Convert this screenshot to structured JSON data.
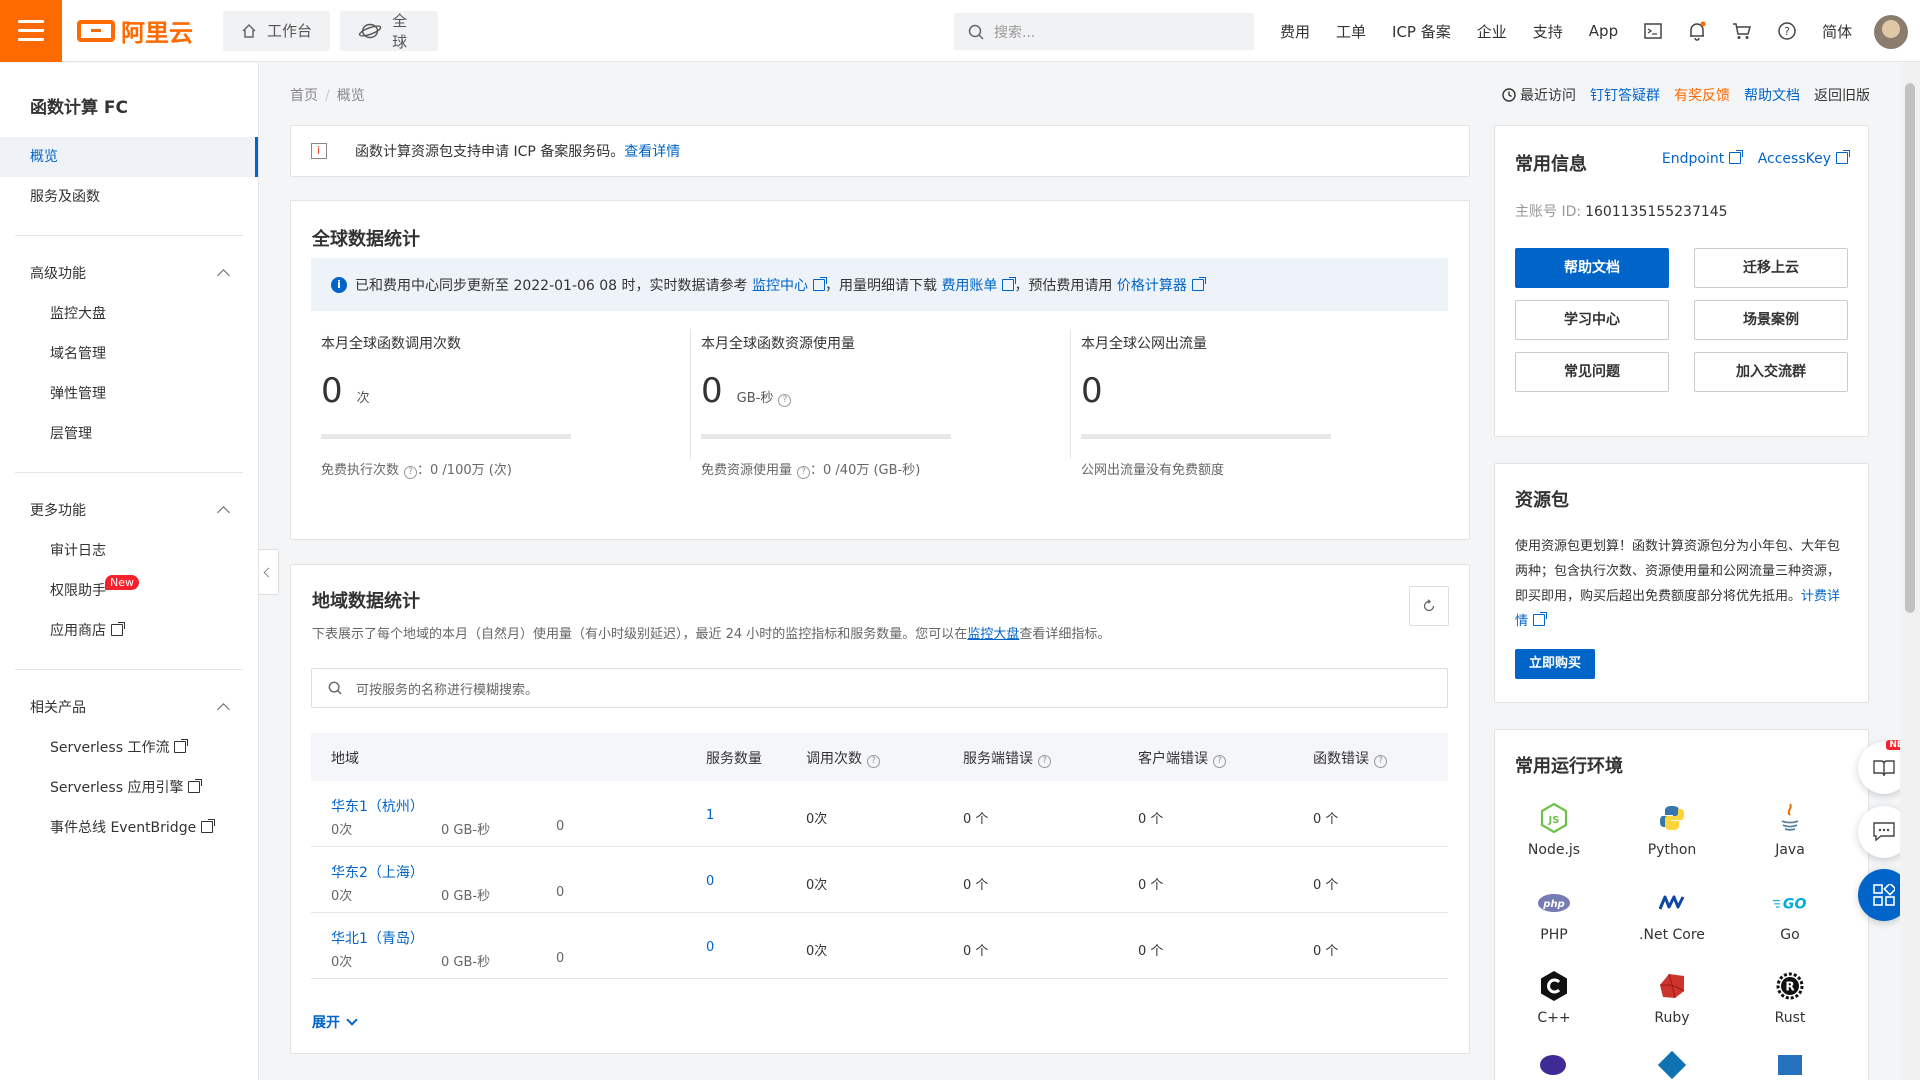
{
  "topbar": {
    "logo": "阿里云",
    "workbench": "工作台",
    "region": "全球",
    "search_placeholder": "搜索...",
    "nav": [
      "费用",
      "工单",
      "ICP 备案",
      "企业",
      "支持",
      "App"
    ],
    "lang": "简体",
    "brand_color": "#ff6a00"
  },
  "sidebar": {
    "title": "函数计算 FC",
    "items": [
      {
        "label": "概览"
      },
      {
        "label": "服务及函数"
      }
    ],
    "advanced": {
      "title": "高级功能",
      "items": [
        "监控大盘",
        "域名管理",
        "弹性管理",
        "层管理"
      ]
    },
    "more": {
      "title": "更多功能",
      "items": [
        "审计日志",
        "权限助手",
        "应用商店"
      ],
      "badge": "New"
    },
    "related": {
      "title": "相关产品",
      "items": [
        "Serverless 工作流",
        "Serverless 应用引擎",
        "事件总线 EventBridge"
      ]
    }
  },
  "breadcrumb": {
    "home": "首页",
    "current": "概览",
    "sep": "/"
  },
  "toplinks": {
    "recent": "最近访问",
    "dingding": "钉钉答疑群",
    "feedback": "有奖反馈",
    "docs": "帮助文档",
    "old": "返回旧版"
  },
  "notice": {
    "text": "函数计算资源包支持申请 ICP 备案服务码。",
    "link": "查看详情"
  },
  "global": {
    "title": "全球数据统计",
    "info": {
      "t1": "已和费用中心同步更新至 2022-01-06 08 时，实时数据请参考",
      "l1": "监控中心",
      "t2": "，用量明细请下载",
      "l2": "费用账单",
      "t3": "，预估费用请用",
      "l3": "价格计算器"
    },
    "stats": [
      {
        "label": "本月全球函数调用次数",
        "value": "0",
        "unit": "次",
        "foot": "免费执行次数",
        "foot_val": "：0 /100万 (次)"
      },
      {
        "label": "本月全球函数资源使用量",
        "value": "0",
        "unit": "GB-秒",
        "foot": "免费资源使用量",
        "foot_val": "：0 /40万 (GB-秒)"
      },
      {
        "label": "本月全球公网出流量",
        "value": "0",
        "unit": "",
        "foot": "公网出流量没有免费额度",
        "foot_val": ""
      }
    ]
  },
  "region": {
    "title": "地域数据统计",
    "desc1": "下表展示了每个地域的本月（自然月）使用量（有小时级别延迟），最近 24 小时的监控指标和服务数量。您可以在",
    "desc_link": "监控大盘",
    "desc2": "查看详细指标。",
    "search_placeholder": "可按服务的名称进行模糊搜索。",
    "headers": [
      "地域",
      "服务数量",
      "调用次数",
      "服务端错误",
      "客户端错误",
      "函数错误"
    ],
    "rows": [
      {
        "name": "华东1（杭州）",
        "sub1": "0次",
        "sub2": "0 GB-秒",
        "sub3": "0",
        "services": "1",
        "calls": "0次",
        "server_err": "0 个",
        "client_err": "0 个",
        "func_err": "0 个"
      },
      {
        "name": "华东2（上海）",
        "sub1": "0次",
        "sub2": "0 GB-秒",
        "sub3": "0",
        "services": "0",
        "calls": "0次",
        "server_err": "0 个",
        "client_err": "0 个",
        "func_err": "0 个"
      },
      {
        "name": "华北1（青岛）",
        "sub1": "0次",
        "sub2": "0 GB-秒",
        "sub3": "0",
        "services": "0",
        "calls": "0次",
        "server_err": "0 个",
        "client_err": "0 个",
        "func_err": "0 个"
      }
    ],
    "expand": "展开"
  },
  "info": {
    "title": "常用信息",
    "endpoint": "Endpoint",
    "accesskey": "AccessKey",
    "account_label": "主账号 ID:",
    "account_id": "1601135155237145",
    "buttons": [
      "帮助文档",
      "迁移上云",
      "学习中心",
      "场景案例",
      "常见问题",
      "加入交流群"
    ]
  },
  "package": {
    "title": "资源包",
    "text": "使用资源包更划算！函数计算资源包分为小年包、大年包两种；包含执行次数、资源使用量和公网流量三种资源，即买即用，购买后超出免费额度部分将优先抵用。",
    "link": "计费详情",
    "buy": "立即购买"
  },
  "runtimes": {
    "title": "常用运行环境",
    "items": [
      "Node.js",
      "Python",
      "Java",
      "PHP",
      ".Net Core",
      "Go",
      "C++",
      "Ruby",
      "Rust"
    ]
  },
  "float_badge": "NEW",
  "colors": {
    "primary": "#0064c8",
    "accent": "#ff6a00"
  }
}
